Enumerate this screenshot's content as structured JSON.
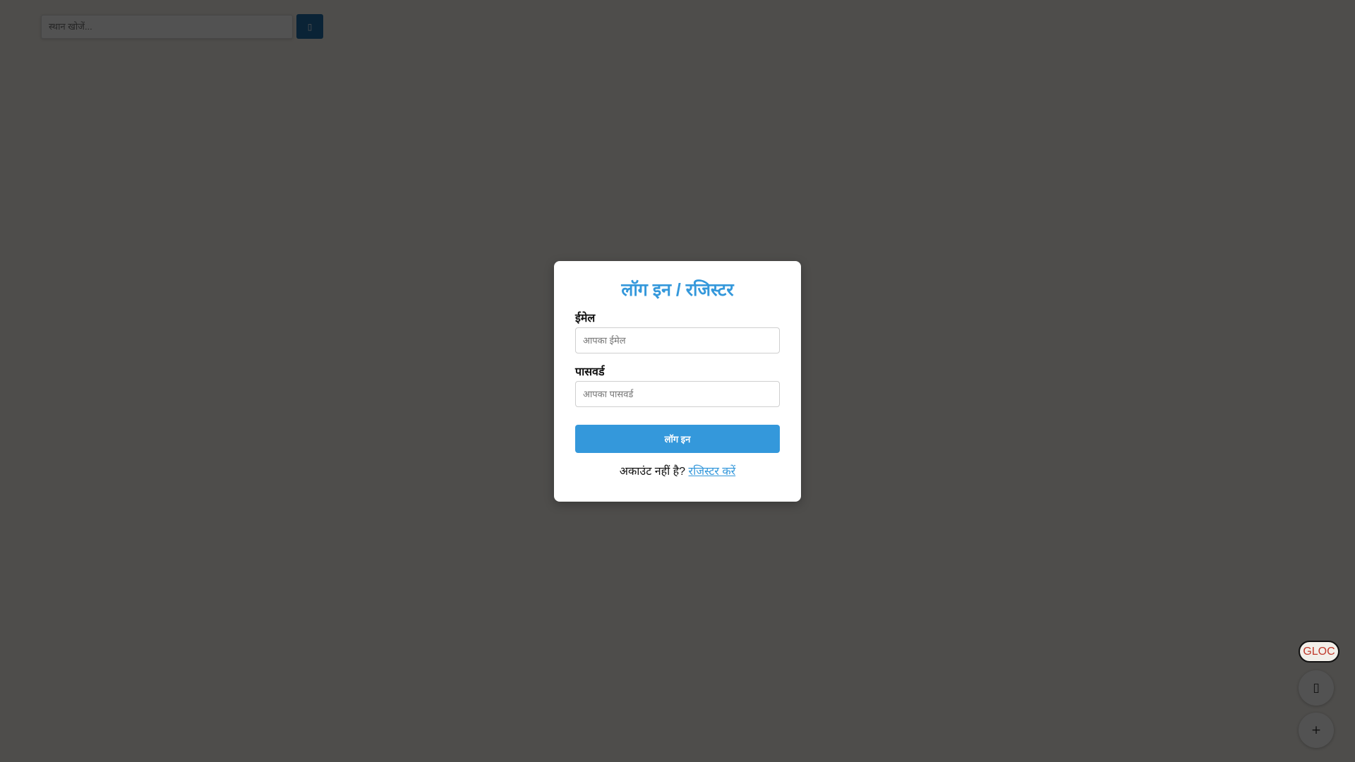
{
  "search": {
    "placeholder": "स्थान खोजें...",
    "button_icon": "search-icon",
    "button_glyph": "▯"
  },
  "login_modal": {
    "title": "लॉग इन / रजिस्टर",
    "email_label": "ईमेल",
    "email_placeholder": "आपका ईमेल",
    "password_label": "पासवर्ड",
    "password_placeholder": "आपका पासवर्ड",
    "login_button": "लॉग इन",
    "no_account_text": "अकाउंट नहीं है?",
    "register_link": "रजिस्टर करें"
  },
  "map_controls": {
    "badge": "GLOC",
    "locate_icon": "locate-icon",
    "locate_glyph": "▯",
    "add_icon": "plus-icon",
    "add_glyph": "+"
  },
  "colors": {
    "accent": "#3498db",
    "search_button": "#1f6ea8",
    "overlay": "rgba(0,0,0,0.68)",
    "badge_text": "#c0392b"
  }
}
